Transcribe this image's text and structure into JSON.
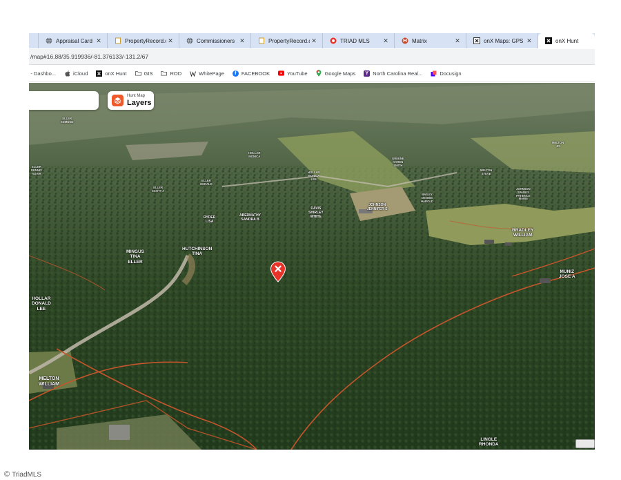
{
  "tabs": [
    {
      "label": "Appraisal Card",
      "icon": "globe-icon"
    },
    {
      "label": "PropertyRecord.c",
      "icon": "page-icon"
    },
    {
      "label": "Commissioners",
      "icon": "globe-icon"
    },
    {
      "label": "PropertyRecord.c",
      "icon": "page-icon"
    },
    {
      "label": "TRIAD MLS",
      "icon": "triad-icon"
    },
    {
      "label": "Matrix",
      "icon": "matrix-icon"
    },
    {
      "label": "onX Maps: GPS M",
      "icon": "onx-icon"
    },
    {
      "label": "onX Hunt",
      "icon": "onx-icon",
      "active": true
    }
  ],
  "close_glyph": "✕",
  "address": {
    "url": "/map#16.88/35.919936/-81.376133/-131.2/67"
  },
  "bookmarks": [
    {
      "label": "m - Dashbo...",
      "icon": ""
    },
    {
      "label": "iCloud",
      "icon": "apple-icon"
    },
    {
      "label": "onX Hunt",
      "icon": "onx-icon"
    },
    {
      "label": "GIS",
      "icon": "folder-icon"
    },
    {
      "label": "ROD",
      "icon": "folder-icon"
    },
    {
      "label": "WhitePage",
      "icon": "whitepage-icon"
    },
    {
      "label": "FACEBOOK",
      "icon": "facebook-icon"
    },
    {
      "label": "YouTube",
      "icon": "youtube-icon"
    },
    {
      "label": "Google Maps",
      "icon": "maps-pin-icon"
    },
    {
      "label": "North Carolina Real...",
      "icon": "ncreal-icon"
    },
    {
      "label": "Docusign",
      "icon": "docusign-icon"
    }
  ],
  "map": {
    "layers_button": {
      "small": "Hunt Map",
      "big": "Layers"
    },
    "owners": {
      "hutchinson": "HUTCHINSON\nTINA",
      "mingus": "MINGUS\nTINA\nELLER",
      "hollar_donald": "HOLLAR\nDONALD\nLEE",
      "melton": "MELTON\nWILLIAM",
      "lingle": "LINGLE\nRHONDA",
      "muniz": "MUNIZ\nJOSE A",
      "bradley": "BRADLEY\nWILLIAM",
      "davis": "DAVIS\nSHIRLEY\nWHITE",
      "johnson_a": "JOHNSON\nJENNIFER S",
      "ryder": "RYDER\nLISA",
      "abernathy": "ABERNATHY\nSANDRA B",
      "eller_scott": "ELLER\nSCOTT A",
      "eller_gerald": "ELLER\nGERALD",
      "eller_dennis": "ELLER\nDENNIS\nADAIR",
      "hollar_monica1": "HOLLAR\nMONICA\nLEE",
      "hollar_monica2": "HOLLAR\nMONICA",
      "greene": "GREENE\nKAREN\nSMITH",
      "bailey": "BAILEY\nDENNIS\nHAROLD",
      "melton_steve": "MELTON\nSTEVE",
      "johnson_sparks": "JOHNSON\nSPARKS\nPATIENCE\nMARIE",
      "eller_edmund": "ELLER\nEDMUND",
      "melton_jr": "MELTON\nJR"
    }
  },
  "colors": {
    "accent": "#ef5a2a",
    "pin": "#e8332a",
    "boundary": "#c5552c"
  },
  "watermark": "TriadMLS"
}
